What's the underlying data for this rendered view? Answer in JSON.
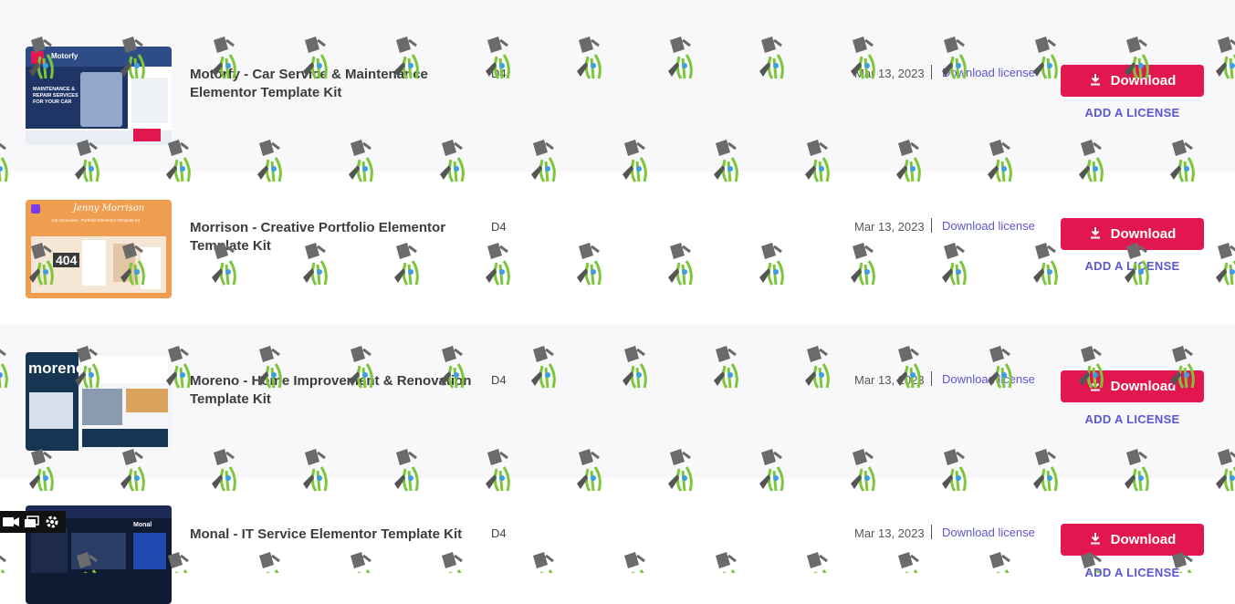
{
  "header": {
    "hint": "."
  },
  "rows": [
    {
      "title": "Motorfy - Car Service & Maintenance Elementor Template Kit",
      "code": "D4",
      "date": "Mar 13, 2023",
      "download_license": "Download license",
      "download_label": "Download",
      "add_license": "ADD A LICENSE",
      "thumb": {
        "brand": "Motorfy",
        "headline": "MAINTENANCE & REPAIR SERVICES FOR YOUR CAR",
        "bg": "#2e4d86",
        "accent": "#e2174f"
      }
    },
    {
      "title": "Morrison - Creative Portfolio Elementor Template Kit",
      "code": "D4",
      "date": "Mar 13, 2023",
      "download_license": "Download license",
      "download_label": "Download",
      "add_license": "ADD A LICENSE",
      "thumb": {
        "brand": "Jenny Morrison",
        "headline": "Job Vacancies - Portfolio Elementor Template Kit",
        "badge": "404",
        "bg": "#ef9d4e",
        "accent": "#3a3a3a"
      }
    },
    {
      "title": "Moreno - Home Improvement & Renovation Template Kit",
      "code": "D4",
      "date": "Mar 13, 2023",
      "download_license": "Download license",
      "download_label": "Download",
      "add_license": "ADD A LICENSE",
      "thumb": {
        "brand": "moreno",
        "bg": "#163552",
        "accent": "#f0a020"
      }
    },
    {
      "title": "Monal - IT Service Elementor Template Kit",
      "code": "D4",
      "date": "Mar 13, 2023",
      "download_license": "Download license",
      "download_label": "Download",
      "add_license": "ADD A LICENSE",
      "thumb": {
        "brand": "Monal",
        "bg": "#0f1a33",
        "accent": "#2b6bff"
      }
    }
  ],
  "colors": {
    "primary": "#e2174f",
    "link": "#5b57d1",
    "row_shade": "#f8f8fa"
  },
  "icons": [
    "download-icon",
    "watering-can-watermark-icon",
    "video-camera-icon",
    "windows-icon",
    "gear-icon"
  ]
}
